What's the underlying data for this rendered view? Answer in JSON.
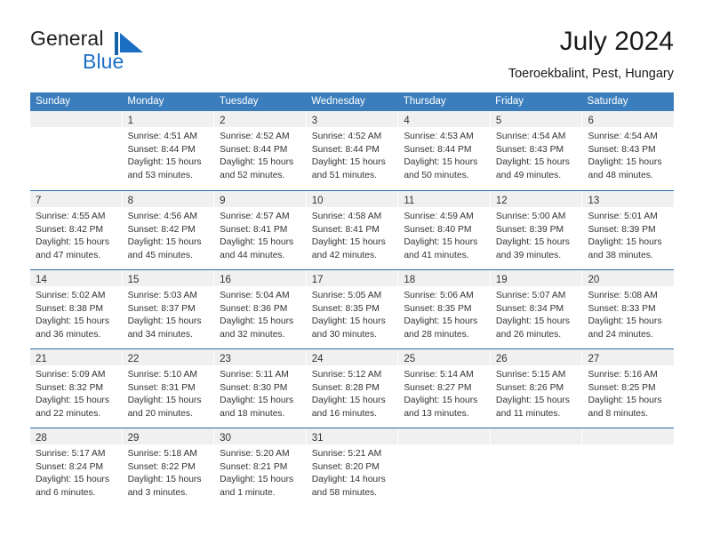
{
  "brand": {
    "name_part1": "General",
    "name_part2": "Blue",
    "mark_icon": "triangle-flag-icon",
    "accent_color": "#1a6fc4"
  },
  "header": {
    "title": "July 2024",
    "subtitle": "Toeroekbalint, Pest, Hungary"
  },
  "colors": {
    "header_blue": "#3b7ebd",
    "row_divider_blue": "#2a6ca8",
    "daynum_strip": "#f0f0f0",
    "text": "#333333"
  },
  "calendar": {
    "weekday_headers": [
      "Sunday",
      "Monday",
      "Tuesday",
      "Wednesday",
      "Thursday",
      "Friday",
      "Saturday"
    ],
    "labels": {
      "sunrise": "Sunrise:",
      "sunset": "Sunset:",
      "daylight": "Daylight:"
    },
    "weeks": [
      [
        {
          "day": "",
          "empty": true,
          "l1": "",
          "l2": "",
          "l3": "",
          "l4": ""
        },
        {
          "day": "1",
          "l1": "Sunrise: 4:51 AM",
          "l2": "Sunset: 8:44 PM",
          "l3": "Daylight: 15 hours",
          "l4": "and 53 minutes."
        },
        {
          "day": "2",
          "l1": "Sunrise: 4:52 AM",
          "l2": "Sunset: 8:44 PM",
          "l3": "Daylight: 15 hours",
          "l4": "and 52 minutes."
        },
        {
          "day": "3",
          "l1": "Sunrise: 4:52 AM",
          "l2": "Sunset: 8:44 PM",
          "l3": "Daylight: 15 hours",
          "l4": "and 51 minutes."
        },
        {
          "day": "4",
          "l1": "Sunrise: 4:53 AM",
          "l2": "Sunset: 8:44 PM",
          "l3": "Daylight: 15 hours",
          "l4": "and 50 minutes."
        },
        {
          "day": "5",
          "l1": "Sunrise: 4:54 AM",
          "l2": "Sunset: 8:43 PM",
          "l3": "Daylight: 15 hours",
          "l4": "and 49 minutes."
        },
        {
          "day": "6",
          "l1": "Sunrise: 4:54 AM",
          "l2": "Sunset: 8:43 PM",
          "l3": "Daylight: 15 hours",
          "l4": "and 48 minutes."
        }
      ],
      [
        {
          "day": "7",
          "l1": "Sunrise: 4:55 AM",
          "l2": "Sunset: 8:42 PM",
          "l3": "Daylight: 15 hours",
          "l4": "and 47 minutes."
        },
        {
          "day": "8",
          "l1": "Sunrise: 4:56 AM",
          "l2": "Sunset: 8:42 PM",
          "l3": "Daylight: 15 hours",
          "l4": "and 45 minutes."
        },
        {
          "day": "9",
          "l1": "Sunrise: 4:57 AM",
          "l2": "Sunset: 8:41 PM",
          "l3": "Daylight: 15 hours",
          "l4": "and 44 minutes."
        },
        {
          "day": "10",
          "l1": "Sunrise: 4:58 AM",
          "l2": "Sunset: 8:41 PM",
          "l3": "Daylight: 15 hours",
          "l4": "and 42 minutes."
        },
        {
          "day": "11",
          "l1": "Sunrise: 4:59 AM",
          "l2": "Sunset: 8:40 PM",
          "l3": "Daylight: 15 hours",
          "l4": "and 41 minutes."
        },
        {
          "day": "12",
          "l1": "Sunrise: 5:00 AM",
          "l2": "Sunset: 8:39 PM",
          "l3": "Daylight: 15 hours",
          "l4": "and 39 minutes."
        },
        {
          "day": "13",
          "l1": "Sunrise: 5:01 AM",
          "l2": "Sunset: 8:39 PM",
          "l3": "Daylight: 15 hours",
          "l4": "and 38 minutes."
        }
      ],
      [
        {
          "day": "14",
          "l1": "Sunrise: 5:02 AM",
          "l2": "Sunset: 8:38 PM",
          "l3": "Daylight: 15 hours",
          "l4": "and 36 minutes."
        },
        {
          "day": "15",
          "l1": "Sunrise: 5:03 AM",
          "l2": "Sunset: 8:37 PM",
          "l3": "Daylight: 15 hours",
          "l4": "and 34 minutes."
        },
        {
          "day": "16",
          "l1": "Sunrise: 5:04 AM",
          "l2": "Sunset: 8:36 PM",
          "l3": "Daylight: 15 hours",
          "l4": "and 32 minutes."
        },
        {
          "day": "17",
          "l1": "Sunrise: 5:05 AM",
          "l2": "Sunset: 8:35 PM",
          "l3": "Daylight: 15 hours",
          "l4": "and 30 minutes."
        },
        {
          "day": "18",
          "l1": "Sunrise: 5:06 AM",
          "l2": "Sunset: 8:35 PM",
          "l3": "Daylight: 15 hours",
          "l4": "and 28 minutes."
        },
        {
          "day": "19",
          "l1": "Sunrise: 5:07 AM",
          "l2": "Sunset: 8:34 PM",
          "l3": "Daylight: 15 hours",
          "l4": "and 26 minutes."
        },
        {
          "day": "20",
          "l1": "Sunrise: 5:08 AM",
          "l2": "Sunset: 8:33 PM",
          "l3": "Daylight: 15 hours",
          "l4": "and 24 minutes."
        }
      ],
      [
        {
          "day": "21",
          "l1": "Sunrise: 5:09 AM",
          "l2": "Sunset: 8:32 PM",
          "l3": "Daylight: 15 hours",
          "l4": "and 22 minutes."
        },
        {
          "day": "22",
          "l1": "Sunrise: 5:10 AM",
          "l2": "Sunset: 8:31 PM",
          "l3": "Daylight: 15 hours",
          "l4": "and 20 minutes."
        },
        {
          "day": "23",
          "l1": "Sunrise: 5:11 AM",
          "l2": "Sunset: 8:30 PM",
          "l3": "Daylight: 15 hours",
          "l4": "and 18 minutes."
        },
        {
          "day": "24",
          "l1": "Sunrise: 5:12 AM",
          "l2": "Sunset: 8:28 PM",
          "l3": "Daylight: 15 hours",
          "l4": "and 16 minutes."
        },
        {
          "day": "25",
          "l1": "Sunrise: 5:14 AM",
          "l2": "Sunset: 8:27 PM",
          "l3": "Daylight: 15 hours",
          "l4": "and 13 minutes."
        },
        {
          "day": "26",
          "l1": "Sunrise: 5:15 AM",
          "l2": "Sunset: 8:26 PM",
          "l3": "Daylight: 15 hours",
          "l4": "and 11 minutes."
        },
        {
          "day": "27",
          "l1": "Sunrise: 5:16 AM",
          "l2": "Sunset: 8:25 PM",
          "l3": "Daylight: 15 hours",
          "l4": "and 8 minutes."
        }
      ],
      [
        {
          "day": "28",
          "l1": "Sunrise: 5:17 AM",
          "l2": "Sunset: 8:24 PM",
          "l3": "Daylight: 15 hours",
          "l4": "and 6 minutes."
        },
        {
          "day": "29",
          "l1": "Sunrise: 5:18 AM",
          "l2": "Sunset: 8:22 PM",
          "l3": "Daylight: 15 hours",
          "l4": "and 3 minutes."
        },
        {
          "day": "30",
          "l1": "Sunrise: 5:20 AM",
          "l2": "Sunset: 8:21 PM",
          "l3": "Daylight: 15 hours",
          "l4": "and 1 minute."
        },
        {
          "day": "31",
          "l1": "Sunrise: 5:21 AM",
          "l2": "Sunset: 8:20 PM",
          "l3": "Daylight: 14 hours",
          "l4": "and 58 minutes."
        },
        {
          "day": "",
          "empty": true,
          "l1": "",
          "l2": "",
          "l3": "",
          "l4": ""
        },
        {
          "day": "",
          "empty": true,
          "l1": "",
          "l2": "",
          "l3": "",
          "l4": ""
        },
        {
          "day": "",
          "empty": true,
          "l1": "",
          "l2": "",
          "l3": "",
          "l4": ""
        }
      ]
    ]
  }
}
